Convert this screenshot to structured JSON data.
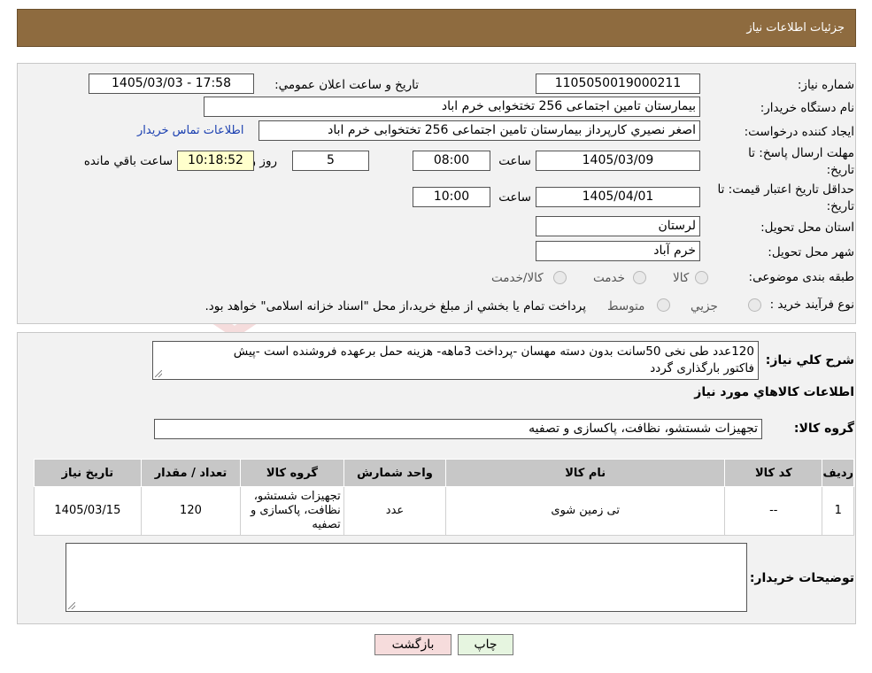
{
  "header": {
    "title": "جزئیات اطلاعات نیاز"
  },
  "form": {
    "need_number_label": "شماره نیاز:",
    "need_number": "1105050019000211",
    "announce_label": "تاریخ و ساعت اعلان عمومي:",
    "announce_value": "1405/03/03 - 17:58",
    "buyer_org_label": "نام دستگاه خريدار:",
    "buyer_org": "بیمارستان تامین اجتماعی  256 تختخوابی خرم اباد",
    "creator_label": "ايجاد کننده درخواست:",
    "creator": "اصغر نصيري كارپرداز بیمارستان تامین اجتماعی  256 تختخوابی خرم اباد",
    "contact_link": "اطلاعات تماس خريدار",
    "deadline_label_1": "مهلت ارسال پاسخ: تا",
    "deadline_label_2": "تاریخ:",
    "deadline_date": "1405/03/09",
    "time_label": "ساعت",
    "deadline_time": "08:00",
    "days_value": "5",
    "days_label": "روز و",
    "remaining_time": "10:18:52",
    "remaining_label": "ساعت باقي مانده",
    "validity_label_1": "حداقل تاريخ اعتبار قيمت: تا",
    "validity_label_2": "تاريخ:",
    "validity_date": "1405/04/01",
    "validity_time": "10:00",
    "province_label": "استان محل تحويل:",
    "province": "لرستان",
    "city_label": "شهر محل تحويل:",
    "city": "خرم آباد",
    "category_label": "طبقه بندی موضوعی:",
    "category_options": [
      "کالا",
      "خدمت",
      "کالا/خدمت"
    ],
    "process_label": "نوع فرآيند خريد :",
    "process_options": [
      "جزيي",
      "متوسط"
    ],
    "process_note": "پرداخت تمام يا بخشي از مبلغ خريد،از محل \"اسناد خزانه اسلامی\" خواهد بود."
  },
  "details": {
    "summary_label": "شرح کلي نياز:",
    "summary_line1": "120عدد طی نخی 50سانت بدون دسته مهسان -پرداخت 3ماهه- هزینه حمل برعهده فروشنده است -پیش",
    "summary_line2": "فاکتور بارگذاری گردد",
    "items_title": "اطلاعات کالاهاي مورد نياز",
    "group_label": "گروه کالا:",
    "group_value": "تجهیزات شستشو، نظافت، پاکسازی و تصفیه",
    "table_headers": [
      "رديف",
      "کد کالا",
      "نام کالا",
      "واحد شمارش",
      "گروه کالا",
      "تعداد / مقدار",
      "تاريخ نياز"
    ],
    "rows": [
      {
        "row": "1",
        "code": "--",
        "name": "تی زمین شوی",
        "unit": "عدد",
        "group": "تجهیزات شستشو، نظافت، پاکسازی و تصفیه",
        "qty": "120",
        "date": "1405/03/15"
      }
    ],
    "notes_label": "توضيحات خريدار:",
    "notes_value": ""
  },
  "buttons": {
    "print": "چاپ",
    "back": "بازگشت"
  },
  "watermark": "AriaTender.neT",
  "colors": {
    "header_bg": "#8e6b3f",
    "link": "#1a3fb0",
    "back_button": "#f6dcdc",
    "print_button": "#e6f5e0",
    "remaining_bg": "#ffffcc"
  }
}
